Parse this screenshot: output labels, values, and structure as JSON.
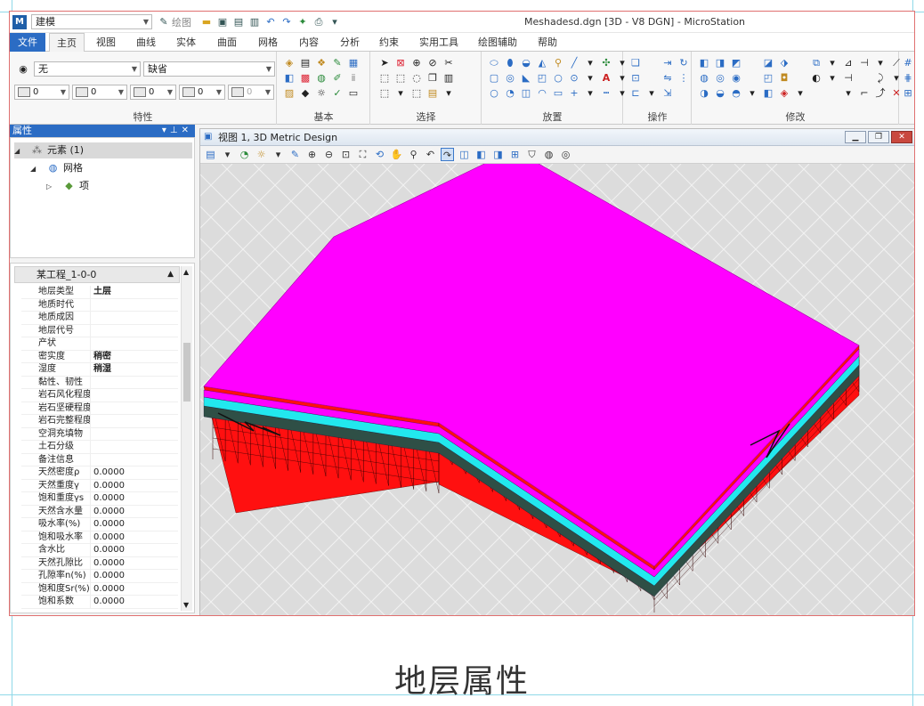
{
  "titlebar": {
    "workspace": "建模",
    "qat_label": "绘图",
    "title": "Meshadesd.dgn [3D - V8 DGN] - MicroStation"
  },
  "tabs": [
    "文件",
    "主页",
    "视图",
    "曲线",
    "实体",
    "曲面",
    "网格",
    "内容",
    "分析",
    "约束",
    "实用工具",
    "绘图辅助",
    "帮助"
  ],
  "ribbon": {
    "attributes": {
      "level": "无",
      "color_label": "缺省",
      "weights": [
        "0",
        "0",
        "0",
        "0",
        "0"
      ],
      "group_label": "特性"
    },
    "groups": [
      "基本",
      "选择",
      "放置",
      "操作",
      "修改"
    ]
  },
  "props_panel": {
    "title": "属性",
    "tree": [
      {
        "label": "元素 (1)"
      },
      {
        "label": "网格"
      },
      {
        "label": "项"
      }
    ]
  },
  "attr_panel": {
    "title": "某工程_1-0-0",
    "rows": [
      {
        "k": "地层类型",
        "v": "土层"
      },
      {
        "k": "地质时代",
        "v": ""
      },
      {
        "k": "地质成因",
        "v": ""
      },
      {
        "k": "地层代号",
        "v": ""
      },
      {
        "k": "产状",
        "v": ""
      },
      {
        "k": "密实度",
        "v": "稍密"
      },
      {
        "k": "湿度",
        "v": "稍湿"
      },
      {
        "k": "黏性、韧性",
        "v": ""
      },
      {
        "k": "岩石风化程度",
        "v": ""
      },
      {
        "k": "岩石坚硬程度",
        "v": ""
      },
      {
        "k": "岩石完整程度",
        "v": ""
      },
      {
        "k": "空洞充填物",
        "v": ""
      },
      {
        "k": "土石分级",
        "v": ""
      },
      {
        "k": "备注信息",
        "v": ""
      },
      {
        "k": "天然密度ρ",
        "v": "0.0000"
      },
      {
        "k": "天然重度γ",
        "v": "0.0000"
      },
      {
        "k": "饱和重度γs",
        "v": "0.0000"
      },
      {
        "k": "天然含水量",
        "v": "0.0000"
      },
      {
        "k": "吸水率(%)",
        "v": "0.0000"
      },
      {
        "k": "饱和吸水率",
        "v": "0.0000"
      },
      {
        "k": "含水比",
        "v": "0.0000"
      },
      {
        "k": "天然孔隙比",
        "v": "0.0000"
      },
      {
        "k": "孔隙率n(%)",
        "v": "0.0000"
      },
      {
        "k": "饱和度Sr(%)",
        "v": "0.0000"
      },
      {
        "k": "饱和系数",
        "v": "0.0000"
      }
    ]
  },
  "view": {
    "title": "视图 1, 3D Metric Design"
  },
  "caption": "地层属性",
  "colors": {
    "top_layer": "#ff00ff",
    "cyan_layer": "#22e8ee",
    "dark_layer": "#2f4f46",
    "base_layer": "#ff1010",
    "accent": "#2b6cc4"
  }
}
